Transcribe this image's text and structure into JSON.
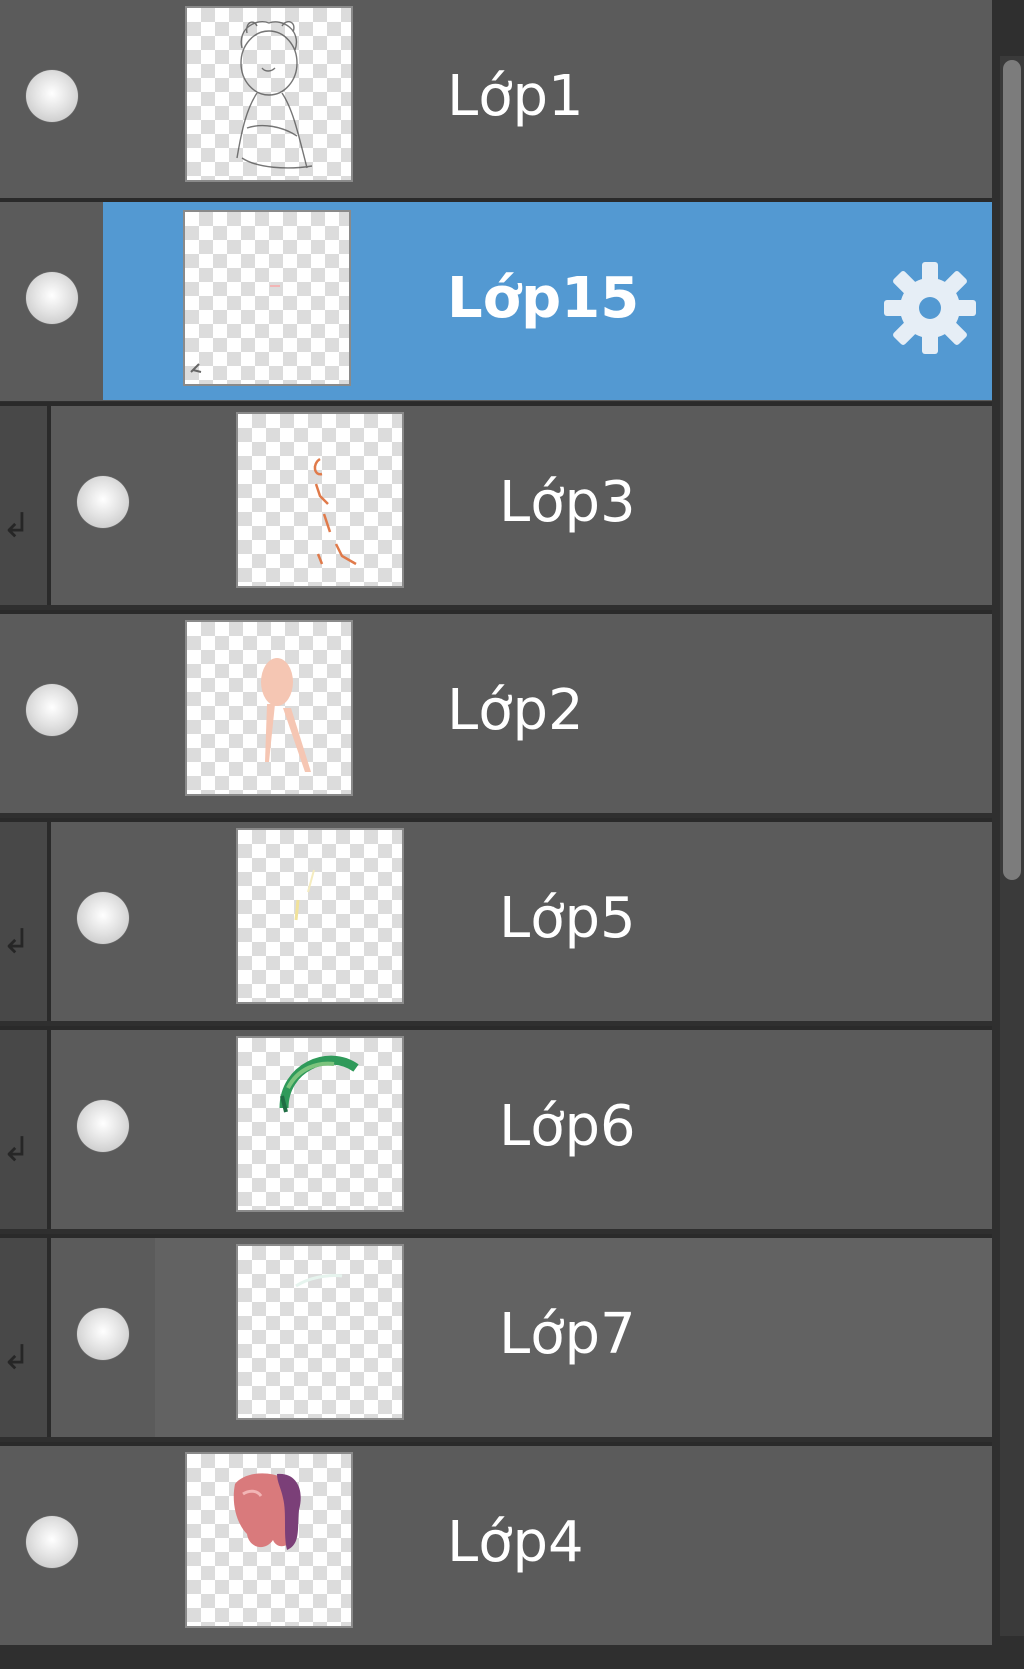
{
  "layers": [
    {
      "name": "Lớp1",
      "clipped": false,
      "selected": false
    },
    {
      "name": "Lớp15",
      "clipped": false,
      "selected": true
    },
    {
      "name": "Lớp3",
      "clipped": true,
      "selected": false
    },
    {
      "name": "Lớp2",
      "clipped": false,
      "selected": false
    },
    {
      "name": "Lớp5",
      "clipped": true,
      "selected": false
    },
    {
      "name": "Lớp6",
      "clipped": true,
      "selected": false
    },
    {
      "name": "Lớp7",
      "clipped": true,
      "selected": false
    },
    {
      "name": "Lớp4",
      "clipped": false,
      "selected": false
    }
  ],
  "icons": {
    "visibility": "eye-dot-icon",
    "settings": "gear-icon",
    "clip": "clip-arrow-icon"
  },
  "colors": {
    "row_bg": "#5b5b5b",
    "selected_bg": "#5399d2",
    "separator": "#2a2a2a"
  }
}
